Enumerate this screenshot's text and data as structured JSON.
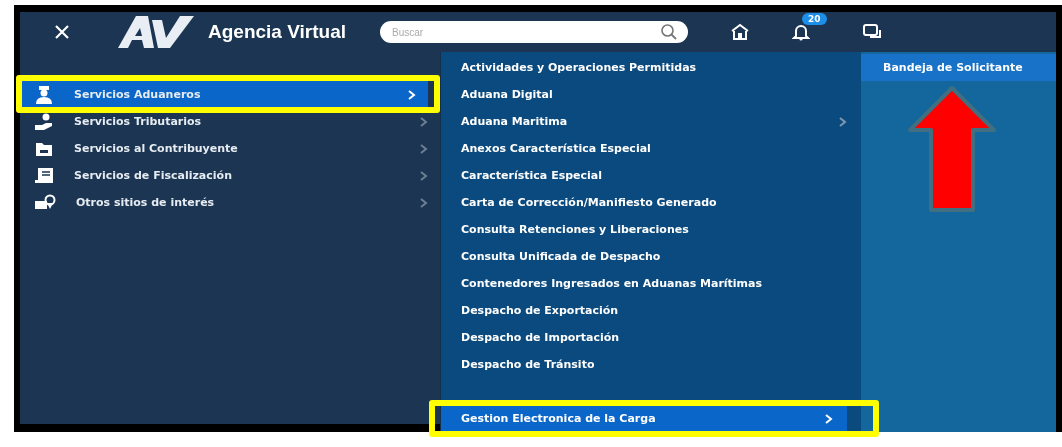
{
  "header": {
    "brand": "Agencia Virtual",
    "search": {
      "placeholder": "Buscar"
    },
    "notifications_badge": "20"
  },
  "main_menu": [
    {
      "label": "Servicios Aduaneros",
      "selected": true,
      "highlighted": true,
      "has_submenu": true
    },
    {
      "label": "Servicios Tributarios",
      "selected": false,
      "highlighted": false,
      "has_submenu": true
    },
    {
      "label": "Servicios al Contribuyente",
      "selected": false,
      "highlighted": false,
      "has_submenu": true
    },
    {
      "label": "Servicios de Fiscalización",
      "selected": false,
      "highlighted": false,
      "has_submenu": true
    },
    {
      "label": "Otros sitios de interés",
      "selected": false,
      "highlighted": false,
      "has_submenu": true
    }
  ],
  "submenu": [
    {
      "label": "Actividades y Operaciones Permitidas",
      "selected": false,
      "highlighted": false,
      "has_submenu": false
    },
    {
      "label": "Aduana Digital",
      "selected": false,
      "highlighted": false,
      "has_submenu": false
    },
    {
      "label": "Aduana Maritima",
      "selected": false,
      "highlighted": false,
      "has_submenu": true
    },
    {
      "label": "Anexos Característica Especial",
      "selected": false,
      "highlighted": false,
      "has_submenu": false
    },
    {
      "label": "Característica Especial",
      "selected": false,
      "highlighted": false,
      "has_submenu": false
    },
    {
      "label": "Carta de Corrección/Manifiesto Generado",
      "selected": false,
      "highlighted": false,
      "has_submenu": false
    },
    {
      "label": "Consulta Retenciones y Liberaciones",
      "selected": false,
      "highlighted": false,
      "has_submenu": false
    },
    {
      "label": "Consulta Unificada de Despacho",
      "selected": false,
      "highlighted": false,
      "has_submenu": false
    },
    {
      "label": "Contenedores Ingresados en Aduanas Marítimas",
      "selected": false,
      "highlighted": false,
      "has_submenu": false
    },
    {
      "label": "Despacho de Exportación",
      "selected": false,
      "highlighted": false,
      "has_submenu": false
    },
    {
      "label": "Despacho de Importación",
      "selected": false,
      "highlighted": false,
      "has_submenu": false
    },
    {
      "label": "Despacho de Tránsito",
      "selected": false,
      "highlighted": false,
      "has_submenu": false
    },
    {
      "label": "Gestion Electronica de la Carga",
      "selected": true,
      "highlighted": true,
      "has_submenu": true
    }
  ],
  "third_menu": {
    "items": [
      {
        "label": "Bandeja de Solicitante",
        "selected": true
      }
    ],
    "arrow_annotation": true
  }
}
